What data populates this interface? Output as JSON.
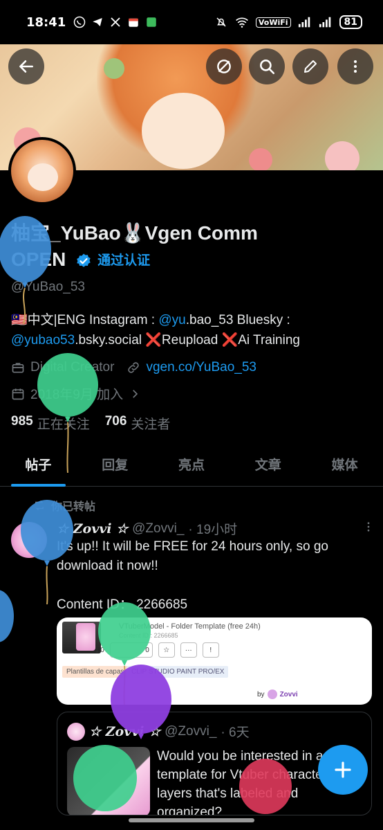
{
  "status_bar": {
    "time": "18:41",
    "network": "VoWiFi",
    "battery": "81"
  },
  "profile": {
    "name": "柚宝_YuBao🐰Vgen Comm",
    "name_line2": "OPEN",
    "verified_text": "通过认证",
    "handle": "@YuBao_53",
    "bio_part1": "🇲🇾中文|ENG Instagram : ",
    "bio_link1": "@yu",
    "bio_part2": ".bao_53 Bluesky : ",
    "bio_link2": "@yubao53",
    "bio_part3": ".bsky.social ❌Reupload ❌Ai Training",
    "category": "Digital Creator",
    "website": "vgen.co/YuBao_53",
    "joined": "2018年9月 加入",
    "following_count": "985",
    "following_label": "正在关注",
    "followers_count": "706",
    "followers_label": "关注者"
  },
  "tabs": [
    "帖子",
    "回复",
    "亮点",
    "文章",
    "媒体"
  ],
  "post": {
    "repost_label": "你已转帖",
    "author_name": "☆ Zovvi ☆",
    "author_handle": "@Zovvi_",
    "time": "· 19小时",
    "text_line1": "It's up!! It will be FREE for 24 hours only, so go download it now!!",
    "text_line2": "Content ID： 2266685",
    "card": {
      "title": "VTuberModel - Folder Template (free 24h)",
      "subtitle": "Content ID : 2266685",
      "count1": "0",
      "count2": "0",
      "tag1": "Plantillas de capas",
      "tag2": "CLIP STUDIO PAINT PRO/EX",
      "by": "by",
      "by_name": "Zovvi"
    },
    "quote": {
      "author_name": "☆ Zovvi ☆",
      "author_handle": "@Zovvi_",
      "time": "· 6天",
      "text": "Would you be interested in a template for Vtuber character layers that's labeled and organized?"
    }
  },
  "colors": {
    "accent": "#1d9bf0",
    "muted": "#71767b",
    "text": "#e7e9ea"
  }
}
